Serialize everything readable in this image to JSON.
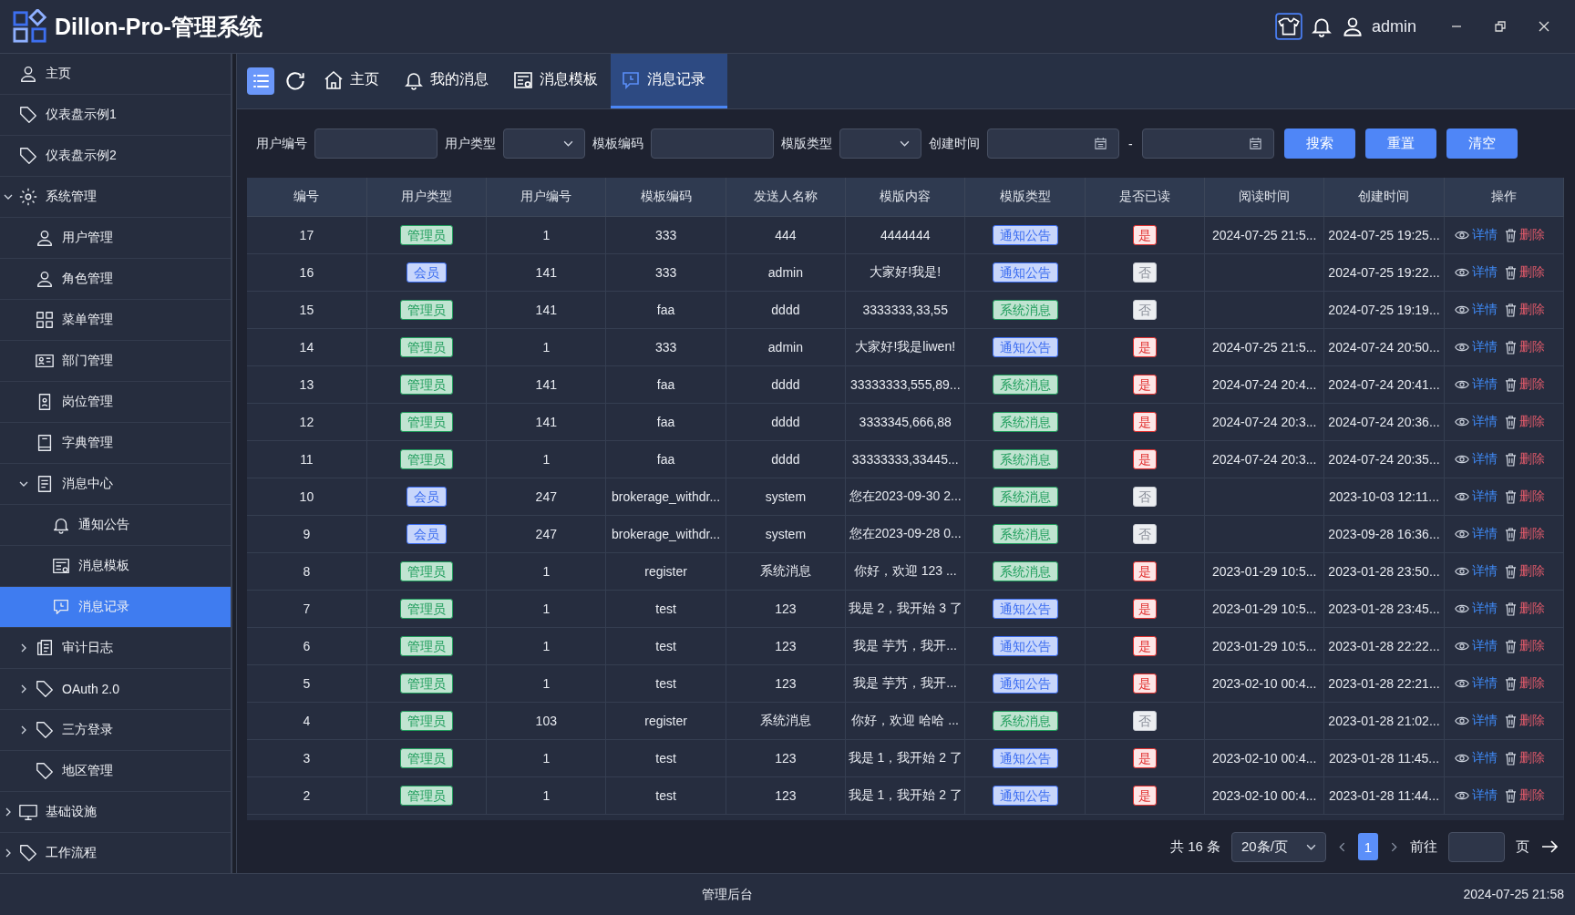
{
  "app": {
    "title": "Dillon-Pro-管理系统",
    "user": "admin"
  },
  "sidebar": {
    "items": [
      {
        "label": "主页",
        "kind": "person",
        "selected": false
      },
      {
        "label": "仪表盘示例1",
        "kind": "tag",
        "selected": false
      },
      {
        "label": "仪表盘示例2",
        "kind": "tag",
        "selected": false
      },
      {
        "label": "系统管理",
        "kind": "gear",
        "selected": false,
        "expanded": true,
        "children": [
          {
            "label": "用户管理",
            "kind": "person",
            "selected": false
          },
          {
            "label": "角色管理",
            "kind": "person",
            "selected": false
          },
          {
            "label": "菜单管理",
            "kind": "grid",
            "selected": false
          },
          {
            "label": "部门管理",
            "kind": "idcard",
            "selected": false
          },
          {
            "label": "岗位管理",
            "kind": "badge",
            "selected": false
          },
          {
            "label": "字典管理",
            "kind": "book",
            "selected": false
          },
          {
            "label": "消息中心",
            "kind": "doc",
            "selected": false,
            "expanded": true,
            "children": [
              {
                "label": "通知公告",
                "kind": "bell",
                "selected": false
              },
              {
                "label": "消息模板",
                "kind": "template",
                "selected": false
              },
              {
                "label": "消息记录",
                "kind": "chat",
                "selected": true
              }
            ]
          },
          {
            "label": "审计日志",
            "kind": "log",
            "selected": false,
            "expanded": false
          },
          {
            "label": "OAuth 2.0",
            "kind": "tag",
            "selected": false,
            "expanded": false
          },
          {
            "label": "三方登录",
            "kind": "tag",
            "selected": false,
            "expanded": false
          },
          {
            "label": "地区管理",
            "kind": "tag",
            "selected": false
          }
        ]
      },
      {
        "label": "基础设施",
        "kind": "monitor",
        "selected": false,
        "expanded": false
      },
      {
        "label": "工作流程",
        "kind": "tag",
        "selected": false,
        "expanded": false
      }
    ]
  },
  "tabs": [
    {
      "label": "主页",
      "kind": "home",
      "selected": false
    },
    {
      "label": "我的消息",
      "kind": "bell",
      "selected": false
    },
    {
      "label": "消息模板",
      "kind": "template",
      "selected": false
    },
    {
      "label": "消息记录",
      "kind": "chat",
      "selected": true
    }
  ],
  "filters": [
    {
      "label": "用户编号",
      "kind": "text"
    },
    {
      "label": "用户类型",
      "kind": "select"
    },
    {
      "label": "模板编码",
      "kind": "text"
    },
    {
      "label": "模版类型",
      "kind": "select"
    },
    {
      "label": "创建时间",
      "kind": "daterange",
      "separator": "-"
    }
  ],
  "filter_buttons": [
    "搜索",
    "重置",
    "清空"
  ],
  "table": {
    "columns": [
      "编号",
      "用户类型",
      "用户编号",
      "模板编码",
      "发送人名称",
      "模版内容",
      "模版类型",
      "是否已读",
      "阅读时间",
      "创建时间",
      "操作"
    ],
    "rows": [
      {
        "id": "17",
        "user_type": {
          "label": "管理员",
          "color": "#1f9d5c"
        },
        "user_no": "1",
        "template_code": "333",
        "sender": "444",
        "content": "4444444",
        "template_type": {
          "label": "通知公告",
          "color": "#3b6cf0"
        },
        "read": {
          "label": "是",
          "read": true
        },
        "read_time": "2024-07-25 21:5...",
        "created_at": "2024-07-25 19:25...",
        "actions": [
          "详情",
          "删除"
        ]
      },
      {
        "id": "16",
        "user_type": {
          "label": "会员",
          "color": "#3b6cf0"
        },
        "user_no": "141",
        "template_code": "333",
        "sender": "admin",
        "content": "大家好!我是!",
        "template_type": {
          "label": "通知公告",
          "color": "#3b6cf0"
        },
        "read": {
          "label": "否",
          "read": false
        },
        "created_at": "2024-07-25 19:22...",
        "actions": [
          "详情",
          "删除"
        ]
      },
      {
        "id": "15",
        "user_type": {
          "label": "管理员",
          "color": "#1f9d5c"
        },
        "user_no": "141",
        "template_code": "faa",
        "sender": "dddd",
        "content": "3333333,33,55",
        "template_type": {
          "label": "系统消息",
          "color": "#1f9d5c"
        },
        "read": {
          "label": "否",
          "read": false
        },
        "created_at": "2024-07-25 19:19...",
        "actions": [
          "详情",
          "删除"
        ]
      },
      {
        "id": "14",
        "user_type": {
          "label": "管理员",
          "color": "#1f9d5c"
        },
        "user_no": "1",
        "template_code": "333",
        "sender": "admin",
        "content": "大家好!我是liwen!",
        "template_type": {
          "label": "通知公告",
          "color": "#3b6cf0"
        },
        "read": {
          "label": "是",
          "read": true
        },
        "read_time": "2024-07-25 21:5...",
        "created_at": "2024-07-24 20:50...",
        "actions": [
          "详情",
          "删除"
        ]
      },
      {
        "id": "13",
        "user_type": {
          "label": "管理员",
          "color": "#1f9d5c"
        },
        "user_no": "141",
        "template_code": "faa",
        "sender": "dddd",
        "content": "33333333,555,89...",
        "template_type": {
          "label": "系统消息",
          "color": "#1f9d5c"
        },
        "read": {
          "label": "是",
          "read": true
        },
        "read_time": "2024-07-24 20:4...",
        "created_at": "2024-07-24 20:41...",
        "actions": [
          "详情",
          "删除"
        ]
      },
      {
        "id": "12",
        "user_type": {
          "label": "管理员",
          "color": "#1f9d5c"
        },
        "user_no": "141",
        "template_code": "faa",
        "sender": "dddd",
        "content": "3333345,666,88",
        "template_type": {
          "label": "系统消息",
          "color": "#1f9d5c"
        },
        "read": {
          "label": "是",
          "read": true
        },
        "read_time": "2024-07-24 20:3...",
        "created_at": "2024-07-24 20:36...",
        "actions": [
          "详情",
          "删除"
        ]
      },
      {
        "id": "11",
        "user_type": {
          "label": "管理员",
          "color": "#1f9d5c"
        },
        "user_no": "1",
        "template_code": "faa",
        "sender": "dddd",
        "content": "33333333,33445...",
        "template_type": {
          "label": "系统消息",
          "color": "#1f9d5c"
        },
        "read": {
          "label": "是",
          "read": true
        },
        "read_time": "2024-07-24 20:3...",
        "created_at": "2024-07-24 20:35...",
        "actions": [
          "详情",
          "删除"
        ]
      },
      {
        "id": "10",
        "user_type": {
          "label": "会员",
          "color": "#3b6cf0"
        },
        "user_no": "247",
        "template_code": "brokerage_withdr...",
        "sender": "system",
        "content": "您在2023-09-30 2...",
        "template_type": {
          "label": "系统消息",
          "color": "#1f9d5c"
        },
        "read": {
          "label": "否",
          "read": false
        },
        "created_at": "2023-10-03 12:11...",
        "actions": [
          "详情",
          "删除"
        ]
      },
      {
        "id": "9",
        "user_type": {
          "label": "会员",
          "color": "#3b6cf0"
        },
        "user_no": "247",
        "template_code": "brokerage_withdr...",
        "sender": "system",
        "content": "您在2023-09-28 0...",
        "template_type": {
          "label": "系统消息",
          "color": "#1f9d5c"
        },
        "read": {
          "label": "否",
          "read": false
        },
        "created_at": "2023-09-28 16:36...",
        "actions": [
          "详情",
          "删除"
        ]
      },
      {
        "id": "8",
        "user_type": {
          "label": "管理员",
          "color": "#1f9d5c"
        },
        "user_no": "1",
        "template_code": "register",
        "sender": "系统消息",
        "content": "你好，欢迎 123 ...",
        "template_type": {
          "label": "系统消息",
          "color": "#1f9d5c"
        },
        "read": {
          "label": "是",
          "read": true
        },
        "read_time": "2023-01-29 10:5...",
        "created_at": "2023-01-28 23:50...",
        "actions": [
          "详情",
          "删除"
        ]
      },
      {
        "id": "7",
        "user_type": {
          "label": "管理员",
          "color": "#1f9d5c"
        },
        "user_no": "1",
        "template_code": "test",
        "sender": "123",
        "content": "我是 2，我开始 3 了",
        "template_type": {
          "label": "通知公告",
          "color": "#3b6cf0"
        },
        "read": {
          "label": "是",
          "read": true
        },
        "read_time": "2023-01-29 10:5...",
        "created_at": "2023-01-28 23:45...",
        "actions": [
          "详情",
          "删除"
        ]
      },
      {
        "id": "6",
        "user_type": {
          "label": "管理员",
          "color": "#1f9d5c"
        },
        "user_no": "1",
        "template_code": "test",
        "sender": "123",
        "content": "我是 芋艿，我开...",
        "template_type": {
          "label": "通知公告",
          "color": "#3b6cf0"
        },
        "read": {
          "label": "是",
          "read": true
        },
        "read_time": "2023-01-29 10:5...",
        "created_at": "2023-01-28 22:22...",
        "actions": [
          "详情",
          "删除"
        ]
      },
      {
        "id": "5",
        "user_type": {
          "label": "管理员",
          "color": "#1f9d5c"
        },
        "user_no": "1",
        "template_code": "test",
        "sender": "123",
        "content": "我是 芋艿，我开...",
        "template_type": {
          "label": "通知公告",
          "color": "#3b6cf0"
        },
        "read": {
          "label": "是",
          "read": true
        },
        "read_time": "2023-02-10 00:4...",
        "created_at": "2023-01-28 22:21...",
        "actions": [
          "详情",
          "删除"
        ]
      },
      {
        "id": "4",
        "user_type": {
          "label": "管理员",
          "color": "#1f9d5c"
        },
        "user_no": "103",
        "template_code": "register",
        "sender": "系统消息",
        "content": "你好，欢迎 哈哈 ...",
        "template_type": {
          "label": "系统消息",
          "color": "#1f9d5c"
        },
        "read": {
          "label": "否",
          "read": false
        },
        "created_at": "2023-01-28 21:02...",
        "actions": [
          "详情",
          "删除"
        ]
      },
      {
        "id": "3",
        "user_type": {
          "label": "管理员",
          "color": "#1f9d5c"
        },
        "user_no": "1",
        "template_code": "test",
        "sender": "123",
        "content": "我是 1，我开始 2 了",
        "template_type": {
          "label": "通知公告",
          "color": "#3b6cf0"
        },
        "read": {
          "label": "是",
          "read": true
        },
        "read_time": "2023-02-10 00:4...",
        "created_at": "2023-01-28 11:45...",
        "actions": [
          "详情",
          "删除"
        ]
      },
      {
        "id": "2",
        "user_type": {
          "label": "管理员",
          "color": "#1f9d5c"
        },
        "user_no": "1",
        "template_code": "test",
        "sender": "123",
        "content": "我是 1，我开始 2 了",
        "template_type": {
          "label": "通知公告",
          "color": "#3b6cf0"
        },
        "read": {
          "label": "是",
          "read": true
        },
        "read_time": "2023-02-10 00:4...",
        "created_at": "2023-01-28 11:44...",
        "actions": [
          "详情",
          "删除"
        ]
      }
    ]
  },
  "pagination": {
    "total": "共 16 条",
    "page_size": "20条/页",
    "pages": [
      {
        "label": "1",
        "selected": true
      }
    ],
    "goto": "前往",
    "goto_unit": "页"
  },
  "footer": {
    "center": "管理后台",
    "time": "2024-07-25 21:58"
  }
}
